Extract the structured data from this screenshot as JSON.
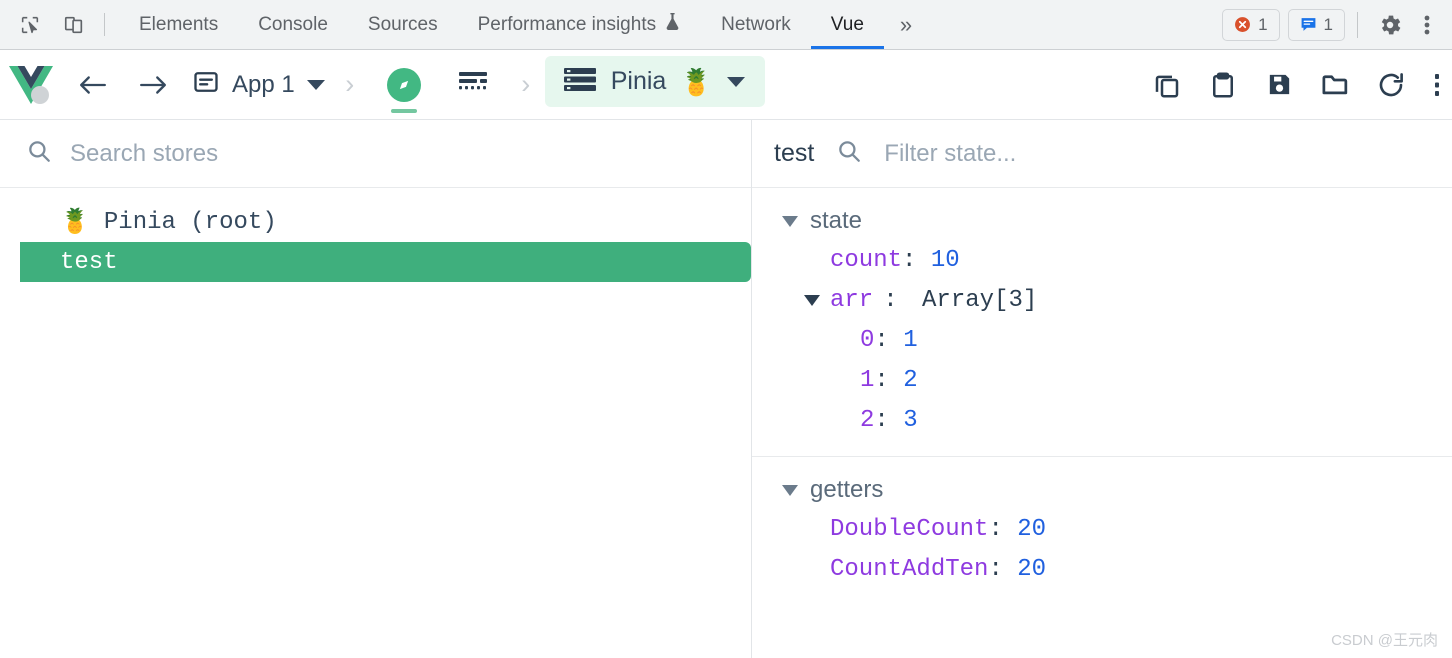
{
  "devtools_bar": {
    "inspect_icon": "inspect-cursor-icon",
    "device_icon": "device-toolbar-icon",
    "tabs": [
      {
        "label": "Elements",
        "active": false,
        "icon": null
      },
      {
        "label": "Console",
        "active": false,
        "icon": null
      },
      {
        "label": "Sources",
        "active": false,
        "icon": null
      },
      {
        "label": "Performance insights",
        "active": false,
        "icon": "flask-icon"
      },
      {
        "label": "Network",
        "active": false,
        "icon": null
      },
      {
        "label": "Vue",
        "active": true,
        "icon": null
      }
    ],
    "overflow_label": "»",
    "error_badge": {
      "icon": "error-circle-icon",
      "count": "1",
      "color": "#d93025"
    },
    "message_badge": {
      "icon": "message-bubble-icon",
      "count": "1",
      "color": "#1a73e8"
    },
    "settings_icon": "gear-icon",
    "more_icon": "kebab-menu-icon",
    "active_underline_color": "#1a73e8"
  },
  "vue_bar": {
    "logo": "vue-logo",
    "back_label": "←",
    "forward_label": "→",
    "app_selector": {
      "icon": "app-window-icon",
      "label": "App 1",
      "caret": "chevron-down-icon"
    },
    "breadcrumb_chevron": "›",
    "inspector_tab": {
      "icon": "compass-icon",
      "selected": true
    },
    "timeline_tab": {
      "icon": "timeline-icon",
      "selected": false
    },
    "pinia_tab": {
      "icon": "list-icon",
      "label": "Pinia",
      "emoji": "🍍",
      "caret": "chevron-down-icon",
      "highlight_color": "#e6f7ee",
      "selected": true
    },
    "actions": [
      {
        "name": "copy-icon"
      },
      {
        "name": "clipboard-paste-icon"
      },
      {
        "name": "save-icon"
      },
      {
        "name": "folder-open-icon"
      },
      {
        "name": "refresh-icon"
      }
    ],
    "more_icon": "kebab-menu-icon",
    "cursor": "pointer-hand-cursor"
  },
  "left_pane": {
    "search": {
      "icon": "search-icon",
      "value": "",
      "placeholder": "Search stores"
    },
    "stores": [
      {
        "emoji": "🍍",
        "label": "Pinia (root)",
        "selected": false
      },
      {
        "emoji": "",
        "label": "test",
        "selected": true
      }
    ],
    "selected_color": "#3faf7d"
  },
  "right_pane": {
    "title": "test",
    "filter": {
      "icon": "search-icon",
      "value": "",
      "placeholder": "Filter state..."
    },
    "sections": [
      {
        "name": "state",
        "expanded": true,
        "entries": [
          {
            "key": "count",
            "sep": ": ",
            "value": "10",
            "value_kind": "number",
            "indent": 1,
            "expandable": false
          },
          {
            "key": "arr",
            "sep": ": ",
            "value": "Array[3]",
            "value_kind": "type",
            "indent": 0,
            "expandable": true,
            "expanded": true
          },
          {
            "key": "0",
            "sep": ": ",
            "value": "1",
            "value_kind": "number",
            "indent": 2,
            "expandable": false
          },
          {
            "key": "1",
            "sep": ": ",
            "value": "2",
            "value_kind": "number",
            "indent": 2,
            "expandable": false
          },
          {
            "key": "2",
            "sep": ": ",
            "value": "3",
            "value_kind": "number",
            "indent": 2,
            "expandable": false
          }
        ]
      },
      {
        "name": "getters",
        "expanded": true,
        "entries": [
          {
            "key": "DoubleCount",
            "sep": ": ",
            "value": "20",
            "value_kind": "number",
            "indent": 1,
            "expandable": false
          },
          {
            "key": "CountAddTen",
            "sep": ": ",
            "value": "20",
            "value_kind": "number",
            "indent": 1,
            "expandable": false
          }
        ]
      }
    ],
    "key_color": "#8e3ae0",
    "value_color": "#2060df"
  },
  "watermark": "CSDN @王元肉"
}
